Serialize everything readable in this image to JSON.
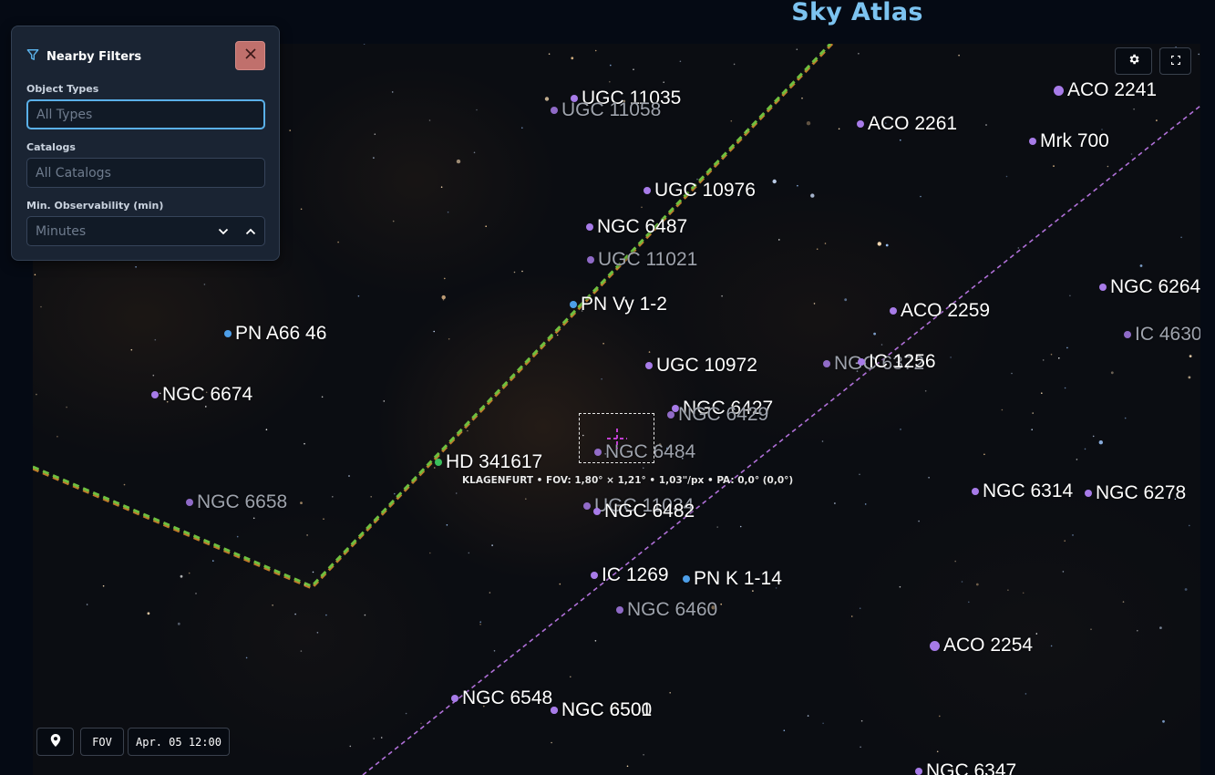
{
  "app": {
    "title": "Sky Atlas"
  },
  "filters": {
    "title": "Nearby Filters",
    "object_types_label": "Object Types",
    "object_types_placeholder": "All Types",
    "catalogs_label": "Catalogs",
    "catalogs_placeholder": "All Catalogs",
    "min_obs_label": "Min. Observability (min)",
    "min_obs_placeholder": "Minutes"
  },
  "fov": {
    "info": "KLAGENFURT • FOV: 1,80° × 1,21° • 1,03\"/px • PA: 0,0° (0,0°)"
  },
  "bottom_bar": {
    "fov_label": "FOV",
    "datetime": "Apr. 05 12:00"
  },
  "icons": {
    "filter": "filter-icon",
    "close": "close-icon",
    "settings": "gear-icon",
    "fullscreen": "fullscreen-icon",
    "location": "location-pin-icon",
    "chevron_down": "chevron-down-icon",
    "chevron_up": "chevron-up-icon"
  },
  "colors": {
    "title": "#7cc3f0",
    "galaxy_marker": "#a77be8",
    "nebula_marker": "#4d9ee8",
    "star_marker": "#3bbf5c",
    "close_button": "#c0706c",
    "ecliptic_line": "#b070d8",
    "horizon_line": "#6fbf3f"
  },
  "objects": [
    {
      "name": "UGC 11035",
      "kind": "galaxy",
      "dim": false
    },
    {
      "name": "UGC 11058",
      "kind": "galaxy",
      "dim": true
    },
    {
      "name": "ACO 2241",
      "kind": "galaxy",
      "dim": false
    },
    {
      "name": "ACO 2261",
      "kind": "galaxy",
      "dim": false
    },
    {
      "name": "Mrk 700",
      "kind": "galaxy",
      "dim": false
    },
    {
      "name": "UGC 10976",
      "kind": "galaxy",
      "dim": false
    },
    {
      "name": "NGC 6487",
      "kind": "galaxy",
      "dim": false
    },
    {
      "name": "UGC 11021",
      "kind": "galaxy",
      "dim": true
    },
    {
      "name": "PN Vy 1-2",
      "kind": "nebula",
      "dim": false
    },
    {
      "name": "NGC 6264",
      "kind": "galaxy",
      "dim": false
    },
    {
      "name": "ACO 2259",
      "kind": "galaxy",
      "dim": false
    },
    {
      "name": "IC 4630",
      "kind": "galaxy",
      "dim": true
    },
    {
      "name": "PN A66 46",
      "kind": "nebula",
      "dim": false
    },
    {
      "name": "UGC 10972",
      "kind": "galaxy",
      "dim": false
    },
    {
      "name": "NGC 6372",
      "kind": "galaxy",
      "dim": true
    },
    {
      "name": "IC 1256",
      "kind": "galaxy",
      "dim": false
    },
    {
      "name": "NGC 6674",
      "kind": "galaxy",
      "dim": false
    },
    {
      "name": "NGC 6427",
      "kind": "galaxy",
      "dim": false
    },
    {
      "name": "NGC 6429",
      "kind": "galaxy",
      "dim": true
    },
    {
      "name": "NGC 6484",
      "kind": "galaxy",
      "dim": true
    },
    {
      "name": "HD 341617",
      "kind": "star",
      "dim": false
    },
    {
      "name": "NGC 6314",
      "kind": "galaxy",
      "dim": false
    },
    {
      "name": "NGC 6278",
      "kind": "galaxy",
      "dim": false
    },
    {
      "name": "NGC 6658",
      "kind": "galaxy",
      "dim": true
    },
    {
      "name": "UGC 11034",
      "kind": "galaxy",
      "dim": true
    },
    {
      "name": "NGC 6482",
      "kind": "galaxy",
      "dim": false
    },
    {
      "name": "IC 1269",
      "kind": "galaxy",
      "dim": false
    },
    {
      "name": "PN K 1-14",
      "kind": "nebula",
      "dim": false
    },
    {
      "name": "NGC 6460",
      "kind": "galaxy",
      "dim": true
    },
    {
      "name": "ACO 2254",
      "kind": "galaxy",
      "dim": false
    },
    {
      "name": "NGC 6548",
      "kind": "galaxy",
      "dim": false
    },
    {
      "name": "NGC 6500",
      "kind": "galaxy",
      "dim": false
    },
    {
      "name": "NGC 6501",
      "kind": "galaxy",
      "dim": false
    },
    {
      "name": "NGC 6347",
      "kind": "galaxy",
      "dim": false
    }
  ]
}
